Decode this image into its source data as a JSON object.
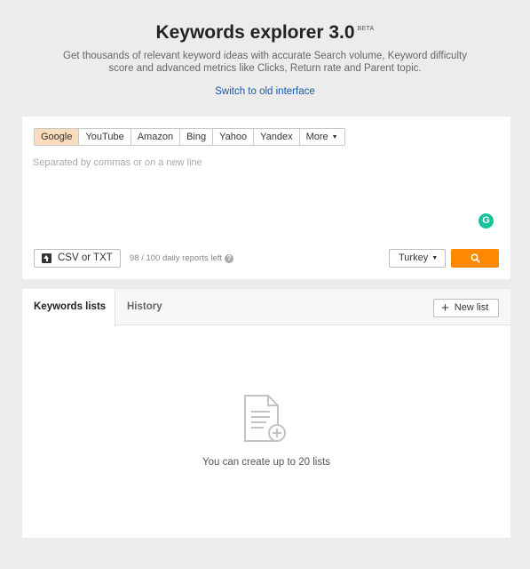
{
  "header": {
    "title": "Keywords explorer 3.0",
    "beta": "BETA",
    "subtitle": "Get thousands of relevant keyword ideas with accurate Search volume, Keyword difficulty score and advanced metrics like Clicks, Return rate and Parent topic.",
    "switch_link": "Switch to old interface"
  },
  "search": {
    "engines": [
      "Google",
      "YouTube",
      "Amazon",
      "Bing",
      "Yahoo",
      "Yandex"
    ],
    "active_engine": "Google",
    "more_label": "More",
    "placeholder": "Separated by commas or on a new line",
    "value": "",
    "csv_button": "CSV or TXT",
    "reports_left": "98 / 100 daily reports left",
    "country": "Turkey",
    "search_button_icon": "search-icon"
  },
  "lists": {
    "tabs": [
      "Keywords lists",
      "History"
    ],
    "active_tab": "Keywords lists",
    "new_list_button": "New list",
    "empty_icon": "document-add-icon",
    "empty_text": "You can create up to 20 lists"
  },
  "colors": {
    "accent": "#ff8800",
    "active_engine_bg": "#fbdcbd",
    "link": "#1a58a8",
    "grammarly": "#15c39a"
  }
}
